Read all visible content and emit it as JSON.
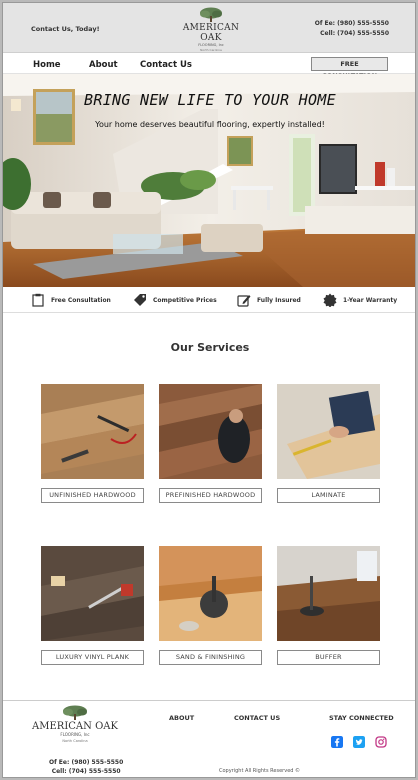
{
  "header": {
    "contact_label": "Contact Us, Today!",
    "logo": {
      "tagline_left": "Quality",
      "tagline_right": "Flooring",
      "name": "AMERICAN OAK",
      "sub": "FLOORING, Inc",
      "location": "North Carolina"
    },
    "phone_office": "Of  Ee: (980) 555-5550",
    "phone_cell": "Cell: (704) 555-5550"
  },
  "nav": {
    "items": [
      "Home",
      "About",
      "Contact Us"
    ],
    "cta": "FREE CONSULTATION"
  },
  "hero": {
    "title": "BRING NEW LIFE TO YOUR HOME",
    "subtitle": "Your home deserves beautiful flooring, expertly installed!"
  },
  "features": [
    {
      "label": "Free Consultation",
      "icon": "clipboard-icon"
    },
    {
      "label": "Competitive Prices",
      "icon": "price-tag-icon"
    },
    {
      "label": "Fully Insured",
      "icon": "edit-document-icon"
    },
    {
      "label": "1-Year Warranty",
      "icon": "badge-seal-icon"
    }
  ],
  "services": {
    "title": "Our Services",
    "items": [
      {
        "label": "UNFINISHED HARDWOOD"
      },
      {
        "label": "PREFINISHED HARDWOOD"
      },
      {
        "label": "LAMINATE"
      },
      {
        "label": "LUXURY VINYL PLANK"
      },
      {
        "label": "SAND & FININSHING"
      },
      {
        "label": "BUFFER"
      }
    ]
  },
  "footer": {
    "logo": {
      "tagline_left": "Quality",
      "tagline_right": "Flooring",
      "name": "AMERICAN OAK",
      "sub": "FLOORING, Inc",
      "location": "North Carolina"
    },
    "phone_office": "Of  Ee: (980) 555-5550",
    "phone_cell": "Cell: (704) 555-5550",
    "about_label": "ABOUT",
    "contact_label": "CONTACT US",
    "stay_connected": "STAY CONNECTED",
    "copyright": "Copyright All Rights Reserved ©",
    "social": [
      {
        "icon": "facebook-icon",
        "color": "#1877f2"
      },
      {
        "icon": "twitter-icon",
        "color": "#1da1f2"
      },
      {
        "icon": "instagram-icon",
        "color": "#c13584"
      }
    ]
  }
}
